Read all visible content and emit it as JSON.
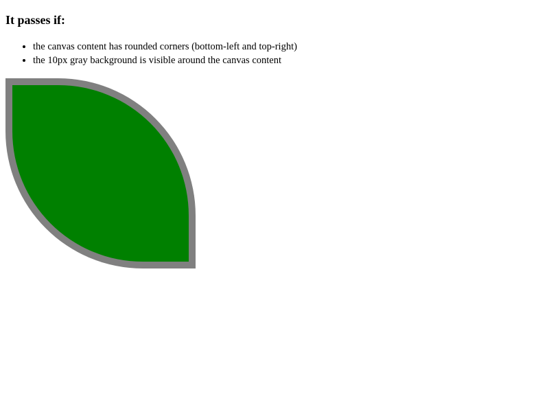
{
  "heading": "It passes if:",
  "criteria": [
    "the canvas content has rounded corners (bottom-left and top-right)",
    "the 10px gray background is visible around the canvas content"
  ],
  "colors": {
    "background": "#ffffff",
    "canvas_border": "#808080",
    "canvas_fill": "#008000"
  }
}
